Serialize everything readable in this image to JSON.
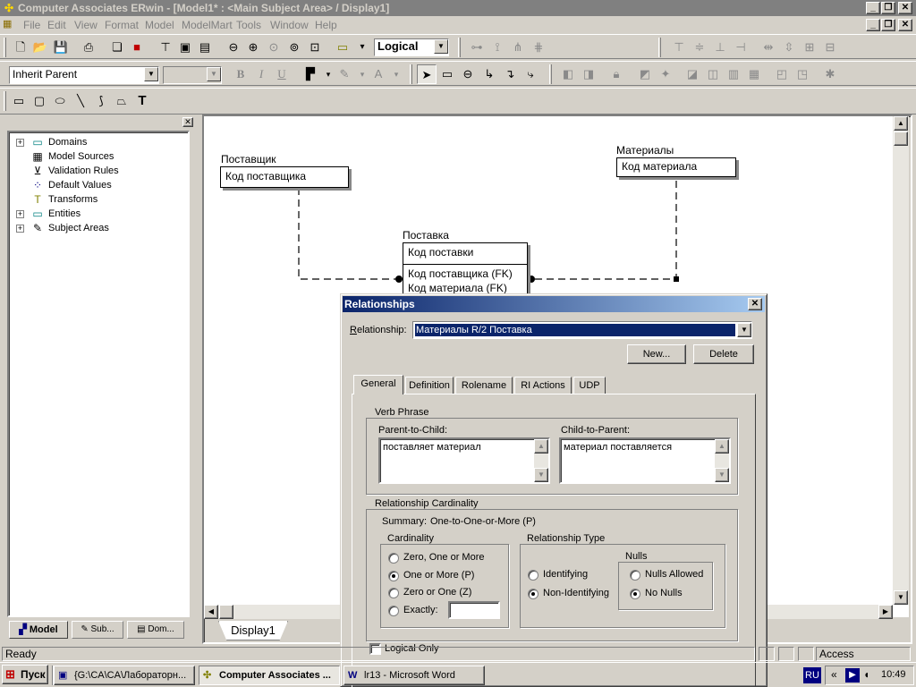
{
  "window": {
    "title": "Computer Associates ERwin - [Model1* : <Main Subject Area> / Display1]",
    "app_icon": "erwin-app-icon"
  },
  "menu": [
    "File",
    "Edit",
    "View",
    "Format",
    "Model",
    "ModelMart",
    "Tools",
    "Window",
    "Help"
  ],
  "toolbar": {
    "view_mode": "Logical",
    "entity_type": "Inherit Parent",
    "font_size": ""
  },
  "left_panel": {
    "tree": [
      {
        "label": "Domains",
        "expandable": true,
        "icon": "domains-icon"
      },
      {
        "label": "Model Sources",
        "expandable": false,
        "icon": "model-sources-icon"
      },
      {
        "label": "Validation Rules",
        "expandable": false,
        "icon": "validation-rules-icon"
      },
      {
        "label": "Default Values",
        "expandable": false,
        "icon": "default-values-icon"
      },
      {
        "label": "Transforms",
        "expandable": false,
        "icon": "transforms-icon"
      },
      {
        "label": "Entities",
        "expandable": true,
        "icon": "entities-icon"
      },
      {
        "label": "Subject Areas",
        "expandable": true,
        "icon": "subject-areas-icon"
      }
    ],
    "tabs": [
      "Model",
      "Sub...",
      "Dom..."
    ]
  },
  "diagram": {
    "entities": [
      {
        "name": "Поставщик",
        "keys": [
          "Код поставщика"
        ],
        "attrs": []
      },
      {
        "name": "Материалы",
        "keys": [
          "Код материала"
        ],
        "attrs": []
      },
      {
        "name": "Поставка",
        "keys": [
          "Код поставки"
        ],
        "attrs": [
          "Код поставщика (FK)",
          "Код материала (FK)"
        ]
      }
    ],
    "tab": "Display1"
  },
  "dialog": {
    "title": "Relationships",
    "relationship_label": "Relationship:",
    "relationship_value": "Материалы R/2 Поставка",
    "new_button": "New...",
    "delete_button": "Delete",
    "tabs": [
      "General",
      "Definition",
      "Rolename",
      "RI Actions",
      "UDP"
    ],
    "verb_phrase": {
      "group": "Verb Phrase",
      "p2c_label": "Parent-to-Child:",
      "p2c_value": "поставляет материал",
      "c2p_label": "Child-to-Parent:",
      "c2p_value": "материал поставляется"
    },
    "cardinality_group": "Relationship Cardinality",
    "summary_label": "Summary:",
    "summary_value": "One-to-One-or-More (P)",
    "cardinality": {
      "group": "Cardinality",
      "options": [
        "Zero, One or More",
        "One or More (P)",
        "Zero or One (Z)",
        "Exactly:"
      ],
      "selected": 1,
      "exactly_value": ""
    },
    "rel_type": {
      "group": "Relationship Type",
      "options": [
        "Identifying",
        "Non-Identifying"
      ],
      "selected": 1
    },
    "nulls": {
      "group": "Nulls",
      "options": [
        "Nulls Allowed",
        "No Nulls"
      ],
      "selected": 1
    },
    "logical_only": "Logical Only"
  },
  "status": {
    "text": "Ready",
    "access": "Access"
  },
  "taskbar": {
    "start": "Пуск",
    "tasks": [
      "{G:\\CA\\CA\\Лабораторн...",
      "Computer Associates ...",
      "lr13 - Microsoft Word"
    ],
    "lang": "RU",
    "time": "10:49"
  }
}
